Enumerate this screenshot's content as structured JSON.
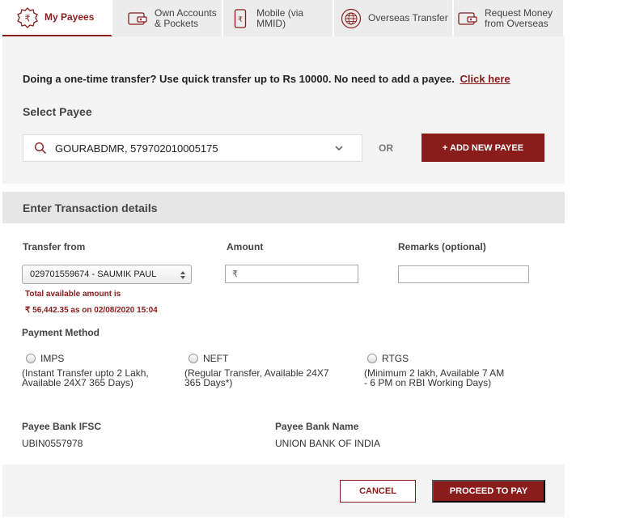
{
  "tabs": [
    {
      "label": "My Payees",
      "icon": "rupee-badge-icon",
      "active": true
    },
    {
      "label_line1": "Own Accounts",
      "label_line2": "& Pockets",
      "icon": "wallet-card-icon"
    },
    {
      "label": "Mobile (via MMID)",
      "icon": "mobile-rupee-icon"
    },
    {
      "label": "Overseas Transfer",
      "icon": "globe-icon"
    },
    {
      "label_line1": "Request Money",
      "label_line2": "from Overseas",
      "icon": "wallet-card-icon"
    }
  ],
  "payee": {
    "onetime_text": "Doing a one-time transfer? Use quick transfer up to Rs 10000. No need to add a payee.",
    "onetime_link": "Click here",
    "select_title": "Select Payee",
    "selected_payee": "GOURABDMR, 579702010005175",
    "or_text": "OR",
    "add_button": "+ ADD NEW PAYEE"
  },
  "transaction": {
    "header": "Enter Transaction details",
    "transfer_from_label": "Transfer from",
    "transfer_from_value": "029701559674 - SAUMIK PAUL",
    "available_line1": "Total available amount is",
    "available_line2": "₹ 56,442.35 as on 02/08/2020 15:04",
    "amount_label": "Amount",
    "amount_prefix": "₹",
    "remarks_label": "Remarks (optional)",
    "payment_method_label": "Payment Method",
    "methods": [
      {
        "name": "IMPS",
        "desc_line1": "(Instant Transfer upto 2 Lakh,",
        "desc_line2": "Available 24X7 365 Days)"
      },
      {
        "name": "NEFT",
        "desc_line1": "(Regular Transfer, Available 24X7",
        "desc_line2": "365 Days*)"
      },
      {
        "name": "RTGS",
        "desc_line1": "(Minimum 2 lakh, Available 7 AM",
        "desc_line2": "- 6 PM on RBI Working Days)"
      }
    ],
    "ifsc_label": "Payee Bank IFSC",
    "ifsc_value": "UBIN0557978",
    "bank_name_label": "Payee Bank Name",
    "bank_name_value": "UNION BANK OF INDIA"
  },
  "footer": {
    "cancel": "CANCEL",
    "proceed": "PROCEED TO PAY"
  },
  "colors": {
    "brand": "#8a1c1c",
    "panel_bg": "#f4f4f4",
    "header_bg": "#e6e6e6"
  }
}
